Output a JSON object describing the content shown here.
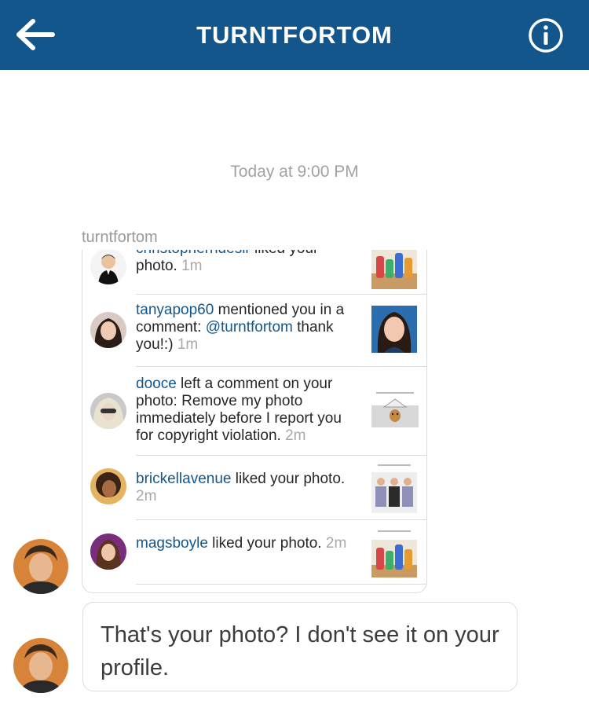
{
  "header": {
    "title": "TURNTFORTOM",
    "back_icon": "back-arrow-icon",
    "info_icon": "info-icon"
  },
  "thread": {
    "timestamp": "Today at 9:00 PM",
    "sender": "turntfortom"
  },
  "shared_post": {
    "notifications": [
      {
        "user": "christopherndesir",
        "text": " liked your photo. ",
        "time": "1m"
      },
      {
        "user": "tanyapop60",
        "text_before": " mentioned you in a comment: ",
        "mention": "@turntfortom",
        "text_after": " thank you!:) ",
        "time": "1m"
      },
      {
        "user": "dooce",
        "text": " left a comment on your photo: Remove my photo immediately before I report you for copyright violation. ",
        "time": "2m"
      },
      {
        "user": "brickellavenue",
        "text": " liked your photo. ",
        "time": "2m"
      },
      {
        "user": "magsboyle",
        "text": " liked your photo. ",
        "time": "2m"
      }
    ]
  },
  "message": {
    "text": "That's your photo? I don't see it on your profile."
  },
  "colors": {
    "header_bg": "#13568b",
    "link": "#13568b",
    "muted": "#a2a2a2"
  }
}
